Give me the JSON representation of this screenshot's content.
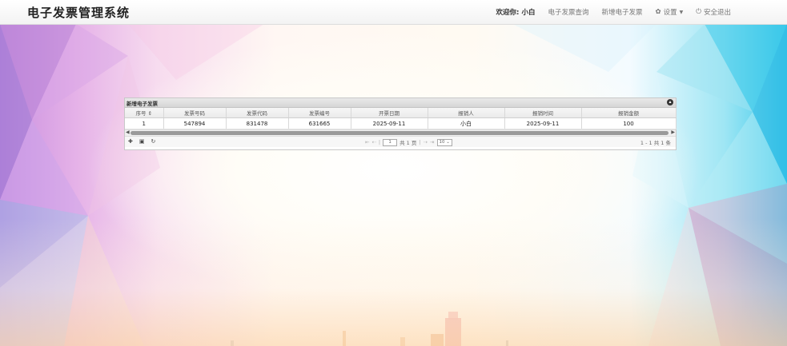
{
  "app": {
    "title": "电子发票管理系统"
  },
  "nav": {
    "welcome_prefix": "欢迎你:",
    "user": "小白",
    "query": "电子发票查询",
    "add": "新增电子发票",
    "settings": "设置",
    "logout": "安全退出"
  },
  "grid": {
    "title": "新增电子发票",
    "columns": [
      "序号",
      "发票号码",
      "发票代码",
      "发票编号",
      "开票日期",
      "报销人",
      "报销时间",
      "报销金额"
    ],
    "rows": [
      [
        "1",
        "547894",
        "831478",
        "631665",
        "2025-09-11",
        "小白",
        "2025-09-11",
        "100"
      ]
    ],
    "pager": {
      "page_value": "1",
      "total_pages": "共 1 页",
      "page_size": "10",
      "record_info": "1 - 1  共 1 条"
    }
  },
  "colors": {
    "accent_left": "#c98fe0",
    "accent_right": "#39c8ea"
  }
}
